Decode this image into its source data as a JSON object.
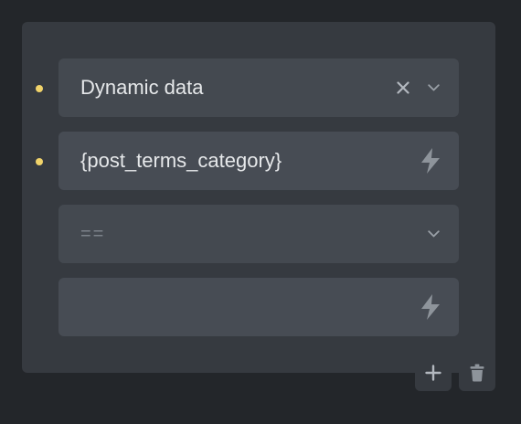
{
  "condition": {
    "source_select": {
      "value": "Dynamic data",
      "clear_icon": "close-icon",
      "dropdown_icon": "chevron-down-icon"
    },
    "key_input": {
      "value": "{post_terms_category}",
      "icon": "lightning-bolt-icon"
    },
    "operator_select": {
      "placeholder": "==",
      "dropdown_icon": "chevron-down-icon"
    },
    "value_input": {
      "value": "",
      "icon": "lightning-bolt-icon"
    }
  },
  "actions": {
    "add_icon": "plus-icon",
    "delete_icon": "trash-icon"
  },
  "colors": {
    "background": "#23262a",
    "panel": "#363a40",
    "field": "#474c54",
    "indicator_dot": "#f1d36a",
    "text": "#e6e8ea",
    "muted_icon": "#8e949b"
  }
}
